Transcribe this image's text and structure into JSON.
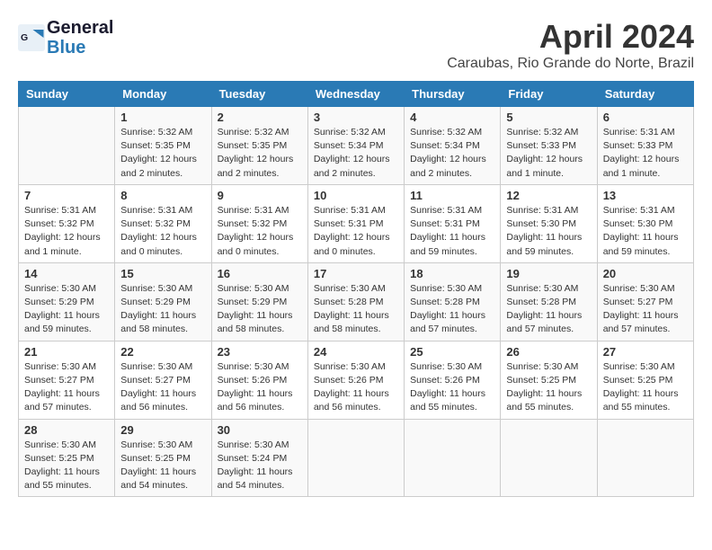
{
  "header": {
    "logo_line1": "General",
    "logo_line2": "Blue",
    "month_title": "April 2024",
    "subtitle": "Caraubas, Rio Grande do Norte, Brazil"
  },
  "weekdays": [
    "Sunday",
    "Monday",
    "Tuesday",
    "Wednesday",
    "Thursday",
    "Friday",
    "Saturday"
  ],
  "weeks": [
    [
      {
        "day": "",
        "info": ""
      },
      {
        "day": "1",
        "info": "Sunrise: 5:32 AM\nSunset: 5:35 PM\nDaylight: 12 hours\nand 2 minutes."
      },
      {
        "day": "2",
        "info": "Sunrise: 5:32 AM\nSunset: 5:35 PM\nDaylight: 12 hours\nand 2 minutes."
      },
      {
        "day": "3",
        "info": "Sunrise: 5:32 AM\nSunset: 5:34 PM\nDaylight: 12 hours\nand 2 minutes."
      },
      {
        "day": "4",
        "info": "Sunrise: 5:32 AM\nSunset: 5:34 PM\nDaylight: 12 hours\nand 2 minutes."
      },
      {
        "day": "5",
        "info": "Sunrise: 5:32 AM\nSunset: 5:33 PM\nDaylight: 12 hours\nand 1 minute."
      },
      {
        "day": "6",
        "info": "Sunrise: 5:31 AM\nSunset: 5:33 PM\nDaylight: 12 hours\nand 1 minute."
      }
    ],
    [
      {
        "day": "7",
        "info": "Sunrise: 5:31 AM\nSunset: 5:32 PM\nDaylight: 12 hours\nand 1 minute."
      },
      {
        "day": "8",
        "info": "Sunrise: 5:31 AM\nSunset: 5:32 PM\nDaylight: 12 hours\nand 0 minutes."
      },
      {
        "day": "9",
        "info": "Sunrise: 5:31 AM\nSunset: 5:32 PM\nDaylight: 12 hours\nand 0 minutes."
      },
      {
        "day": "10",
        "info": "Sunrise: 5:31 AM\nSunset: 5:31 PM\nDaylight: 12 hours\nand 0 minutes."
      },
      {
        "day": "11",
        "info": "Sunrise: 5:31 AM\nSunset: 5:31 PM\nDaylight: 11 hours\nand 59 minutes."
      },
      {
        "day": "12",
        "info": "Sunrise: 5:31 AM\nSunset: 5:30 PM\nDaylight: 11 hours\nand 59 minutes."
      },
      {
        "day": "13",
        "info": "Sunrise: 5:31 AM\nSunset: 5:30 PM\nDaylight: 11 hours\nand 59 minutes."
      }
    ],
    [
      {
        "day": "14",
        "info": "Sunrise: 5:30 AM\nSunset: 5:29 PM\nDaylight: 11 hours\nand 59 minutes."
      },
      {
        "day": "15",
        "info": "Sunrise: 5:30 AM\nSunset: 5:29 PM\nDaylight: 11 hours\nand 58 minutes."
      },
      {
        "day": "16",
        "info": "Sunrise: 5:30 AM\nSunset: 5:29 PM\nDaylight: 11 hours\nand 58 minutes."
      },
      {
        "day": "17",
        "info": "Sunrise: 5:30 AM\nSunset: 5:28 PM\nDaylight: 11 hours\nand 58 minutes."
      },
      {
        "day": "18",
        "info": "Sunrise: 5:30 AM\nSunset: 5:28 PM\nDaylight: 11 hours\nand 57 minutes."
      },
      {
        "day": "19",
        "info": "Sunrise: 5:30 AM\nSunset: 5:28 PM\nDaylight: 11 hours\nand 57 minutes."
      },
      {
        "day": "20",
        "info": "Sunrise: 5:30 AM\nSunset: 5:27 PM\nDaylight: 11 hours\nand 57 minutes."
      }
    ],
    [
      {
        "day": "21",
        "info": "Sunrise: 5:30 AM\nSunset: 5:27 PM\nDaylight: 11 hours\nand 57 minutes."
      },
      {
        "day": "22",
        "info": "Sunrise: 5:30 AM\nSunset: 5:27 PM\nDaylight: 11 hours\nand 56 minutes."
      },
      {
        "day": "23",
        "info": "Sunrise: 5:30 AM\nSunset: 5:26 PM\nDaylight: 11 hours\nand 56 minutes."
      },
      {
        "day": "24",
        "info": "Sunrise: 5:30 AM\nSunset: 5:26 PM\nDaylight: 11 hours\nand 56 minutes."
      },
      {
        "day": "25",
        "info": "Sunrise: 5:30 AM\nSunset: 5:26 PM\nDaylight: 11 hours\nand 55 minutes."
      },
      {
        "day": "26",
        "info": "Sunrise: 5:30 AM\nSunset: 5:25 PM\nDaylight: 11 hours\nand 55 minutes."
      },
      {
        "day": "27",
        "info": "Sunrise: 5:30 AM\nSunset: 5:25 PM\nDaylight: 11 hours\nand 55 minutes."
      }
    ],
    [
      {
        "day": "28",
        "info": "Sunrise: 5:30 AM\nSunset: 5:25 PM\nDaylight: 11 hours\nand 55 minutes."
      },
      {
        "day": "29",
        "info": "Sunrise: 5:30 AM\nSunset: 5:25 PM\nDaylight: 11 hours\nand 54 minutes."
      },
      {
        "day": "30",
        "info": "Sunrise: 5:30 AM\nSunset: 5:24 PM\nDaylight: 11 hours\nand 54 minutes."
      },
      {
        "day": "",
        "info": ""
      },
      {
        "day": "",
        "info": ""
      },
      {
        "day": "",
        "info": ""
      },
      {
        "day": "",
        "info": ""
      }
    ]
  ]
}
